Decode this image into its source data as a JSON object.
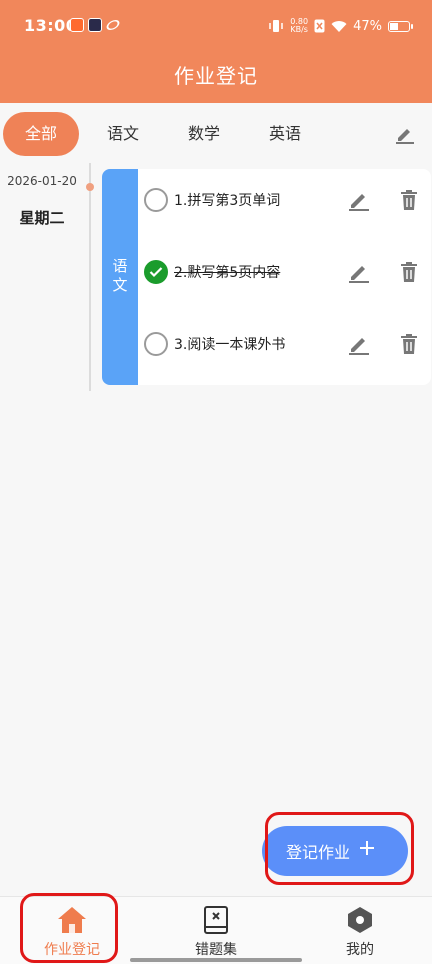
{
  "status_bar": {
    "time": "13:00",
    "net_speed_top": "0.80",
    "net_speed_bottom": "KB/s",
    "battery": "47%",
    "battery_level": 0.47
  },
  "header": {
    "title": "作业登记"
  },
  "tabs": [
    {
      "label": "全部",
      "active": true
    },
    {
      "label": "语文",
      "active": false
    },
    {
      "label": "数学",
      "active": false
    },
    {
      "label": "英语",
      "active": false
    }
  ],
  "timeline": {
    "date": "2026-01-20",
    "weekday": "星期二"
  },
  "card": {
    "subject": "语文",
    "subject_color": "#5aa3f7",
    "tasks": [
      {
        "text": "1.拼写第3页单词",
        "done": false
      },
      {
        "text": "2.默写第5页内容",
        "done": true
      },
      {
        "text": "3.阅读一本课外书",
        "done": false
      }
    ]
  },
  "fab": {
    "label": "登记作业"
  },
  "bottom_nav": [
    {
      "label": "作业登记",
      "icon": "home-icon",
      "active": true
    },
    {
      "label": "错题集",
      "icon": "book-icon",
      "active": false
    },
    {
      "label": "我的",
      "icon": "hexagon-icon",
      "active": false
    }
  ],
  "colors": {
    "accent": "#f1875b",
    "active_tab": "#ef8257",
    "fab": "#5b8ff9",
    "done": "#1b9c2c"
  }
}
